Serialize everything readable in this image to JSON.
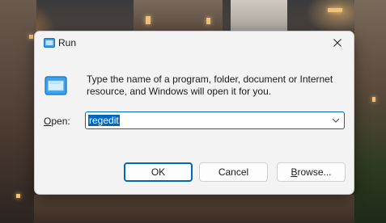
{
  "dialog": {
    "title": "Run",
    "description": "Type the name of a program, folder, document or Internet resource, and Windows will open it for you.",
    "open_label": "pen:",
    "open_label_accesskey": "O",
    "open_value": "regedit",
    "buttons": {
      "ok": "OK",
      "cancel": "Cancel",
      "browse_accesskey": "B",
      "browse_rest": "rowse..."
    }
  },
  "icons": {
    "title": "run-icon",
    "close": "close-icon",
    "large": "run-icon",
    "dropdown": "chevron-down-icon"
  },
  "colors": {
    "accent": "#0067c0",
    "dialog_bg": "#f3f3f3"
  }
}
